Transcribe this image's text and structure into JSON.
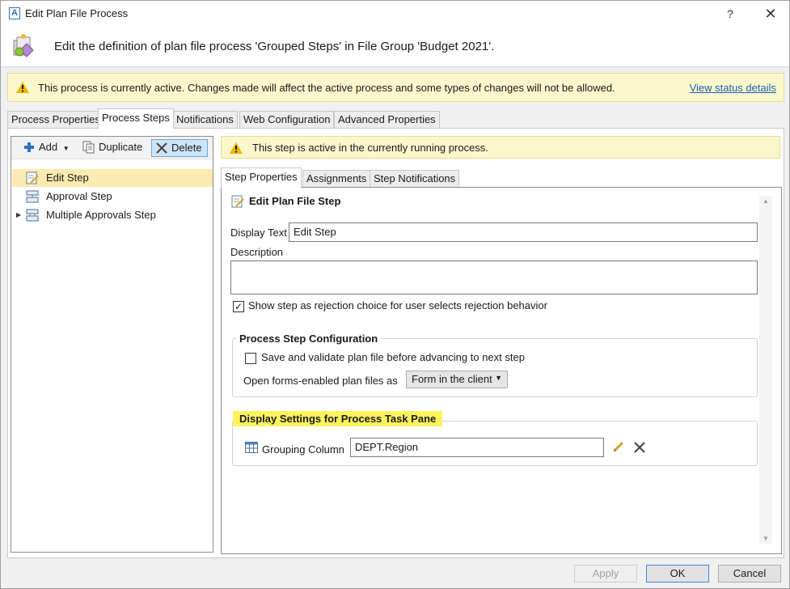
{
  "window": {
    "title": "Edit Plan File Process",
    "app_glyph": "A",
    "help_glyph": "?",
    "close_glyph": "✕"
  },
  "header": {
    "text": "Edit the definition of plan file process 'Grouped Steps' in File Group 'Budget 2021'."
  },
  "banner": {
    "text": "This process is currently active. Changes made will affect the active process and some types of changes will not be allowed.",
    "link": "View status details"
  },
  "tabs": {
    "process_properties": "Process Properties",
    "process_steps": "Process Steps",
    "notifications": "Notifications",
    "web_configuration": "Web Configuration",
    "advanced_properties": "Advanced Properties"
  },
  "toolbar": {
    "add": "Add",
    "duplicate": "Duplicate",
    "delete": "Delete"
  },
  "steps": [
    {
      "label": "Edit Step",
      "icon": "edit-step-icon",
      "selected": true
    },
    {
      "label": "Approval Step",
      "icon": "approval-step-icon",
      "selected": false
    },
    {
      "label": "Multiple Approvals Step",
      "icon": "multiple-approvals-icon",
      "selected": false
    }
  ],
  "step_banner": {
    "text": "This step is active in the currently running process."
  },
  "inner_tabs": {
    "step_properties": "Step Properties",
    "assignments": "Assignments",
    "step_notifications": "Step Notifications"
  },
  "step_properties": {
    "section_title": "Edit Plan File Step",
    "display_text_label": "Display Text",
    "display_text_value": "Edit Step",
    "description_label": "Description",
    "description_value": "",
    "rejection_checkbox_label": "Show step as rejection choice for user selects rejection behavior",
    "rejection_checked": true,
    "config_group_title": "Process Step Configuration",
    "save_validate_label": "Save and validate plan file before advancing to next step",
    "save_validate_checked": false,
    "open_forms_label": "Open forms-enabled plan files as",
    "open_forms_value": "Form in the client",
    "display_group_title": "Display Settings for Process Task Pane",
    "grouping_column_label": "Grouping Column",
    "grouping_column_value": "DEPT.Region"
  },
  "footer": {
    "apply": "Apply",
    "ok": "OK",
    "cancel": "Cancel"
  },
  "colors": {
    "banner_bg": "#fbf7cc",
    "selected_item": "#fdeab0",
    "highlight": "#fff35c",
    "link": "#1a5fb4"
  }
}
